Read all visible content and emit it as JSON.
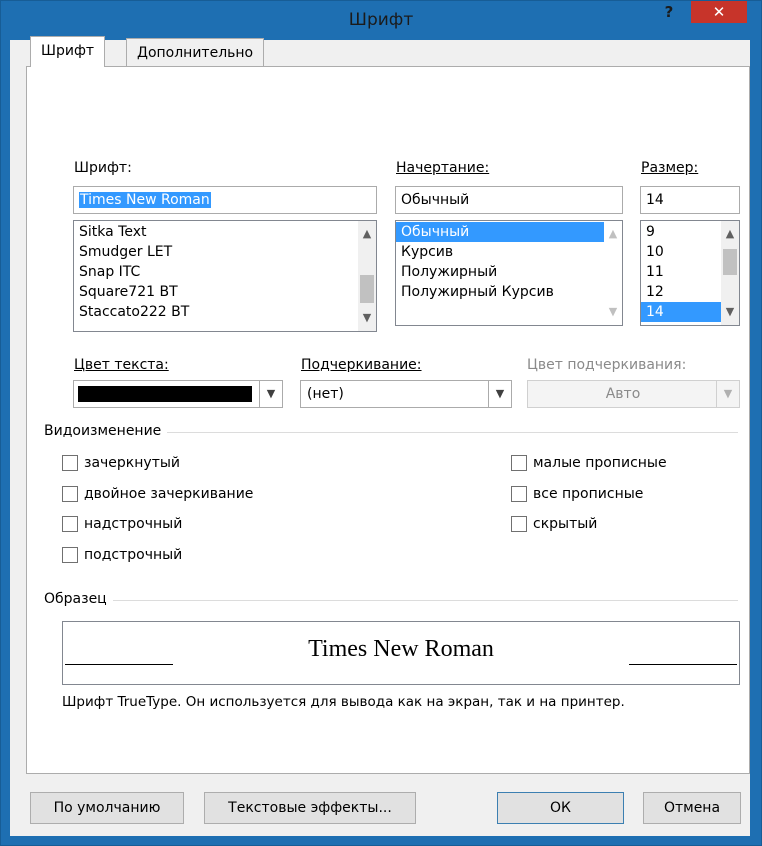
{
  "window": {
    "title": "Шрифт",
    "help_label": "?",
    "close_label": "✕"
  },
  "tabs": [
    {
      "label": "Шрифт"
    },
    {
      "label": "Дополнительно"
    }
  ],
  "font": {
    "label": "Шрифт:",
    "value": "Times New Roman",
    "list": [
      "Sitka Text",
      "Smudger LET",
      "Snap ITC",
      "Square721 BT",
      "Staccato222 BT"
    ]
  },
  "style": {
    "label": "Начертание:",
    "value": "Обычный",
    "list": [
      "Обычный",
      "Курсив",
      "Полужирный",
      "Полужирный Курсив"
    ],
    "selected": "Обычный"
  },
  "size": {
    "label": "Размер:",
    "value": "14",
    "list": [
      "9",
      "10",
      "11",
      "12",
      "14"
    ],
    "selected": "14"
  },
  "text_color": {
    "label": "Цвет текста:",
    "color": "#000000"
  },
  "underline": {
    "label": "Подчеркивание:",
    "value": "(нет)"
  },
  "underline_color": {
    "label": "Цвет подчеркивания:",
    "value": "Авто"
  },
  "effects": {
    "title": "Видоизменение",
    "left": [
      "зачеркнутый",
      "двойное зачеркивание",
      "надстрочный",
      "подстрочный"
    ],
    "right": [
      "малые прописные",
      "все прописные",
      "скрытый"
    ]
  },
  "preview": {
    "title": "Образец",
    "text": "Times New Roman",
    "description": "Шрифт TrueType. Он используется для вывода как на экран, так и на принтер."
  },
  "buttons": {
    "default": "По умолчанию",
    "text_effects": "Текстовые эффекты...",
    "ok": "ОК",
    "cancel": "Отмена"
  },
  "colors": {
    "frame": "#1e6fb2",
    "close": "#c7342a",
    "selection": "#3399ff"
  }
}
